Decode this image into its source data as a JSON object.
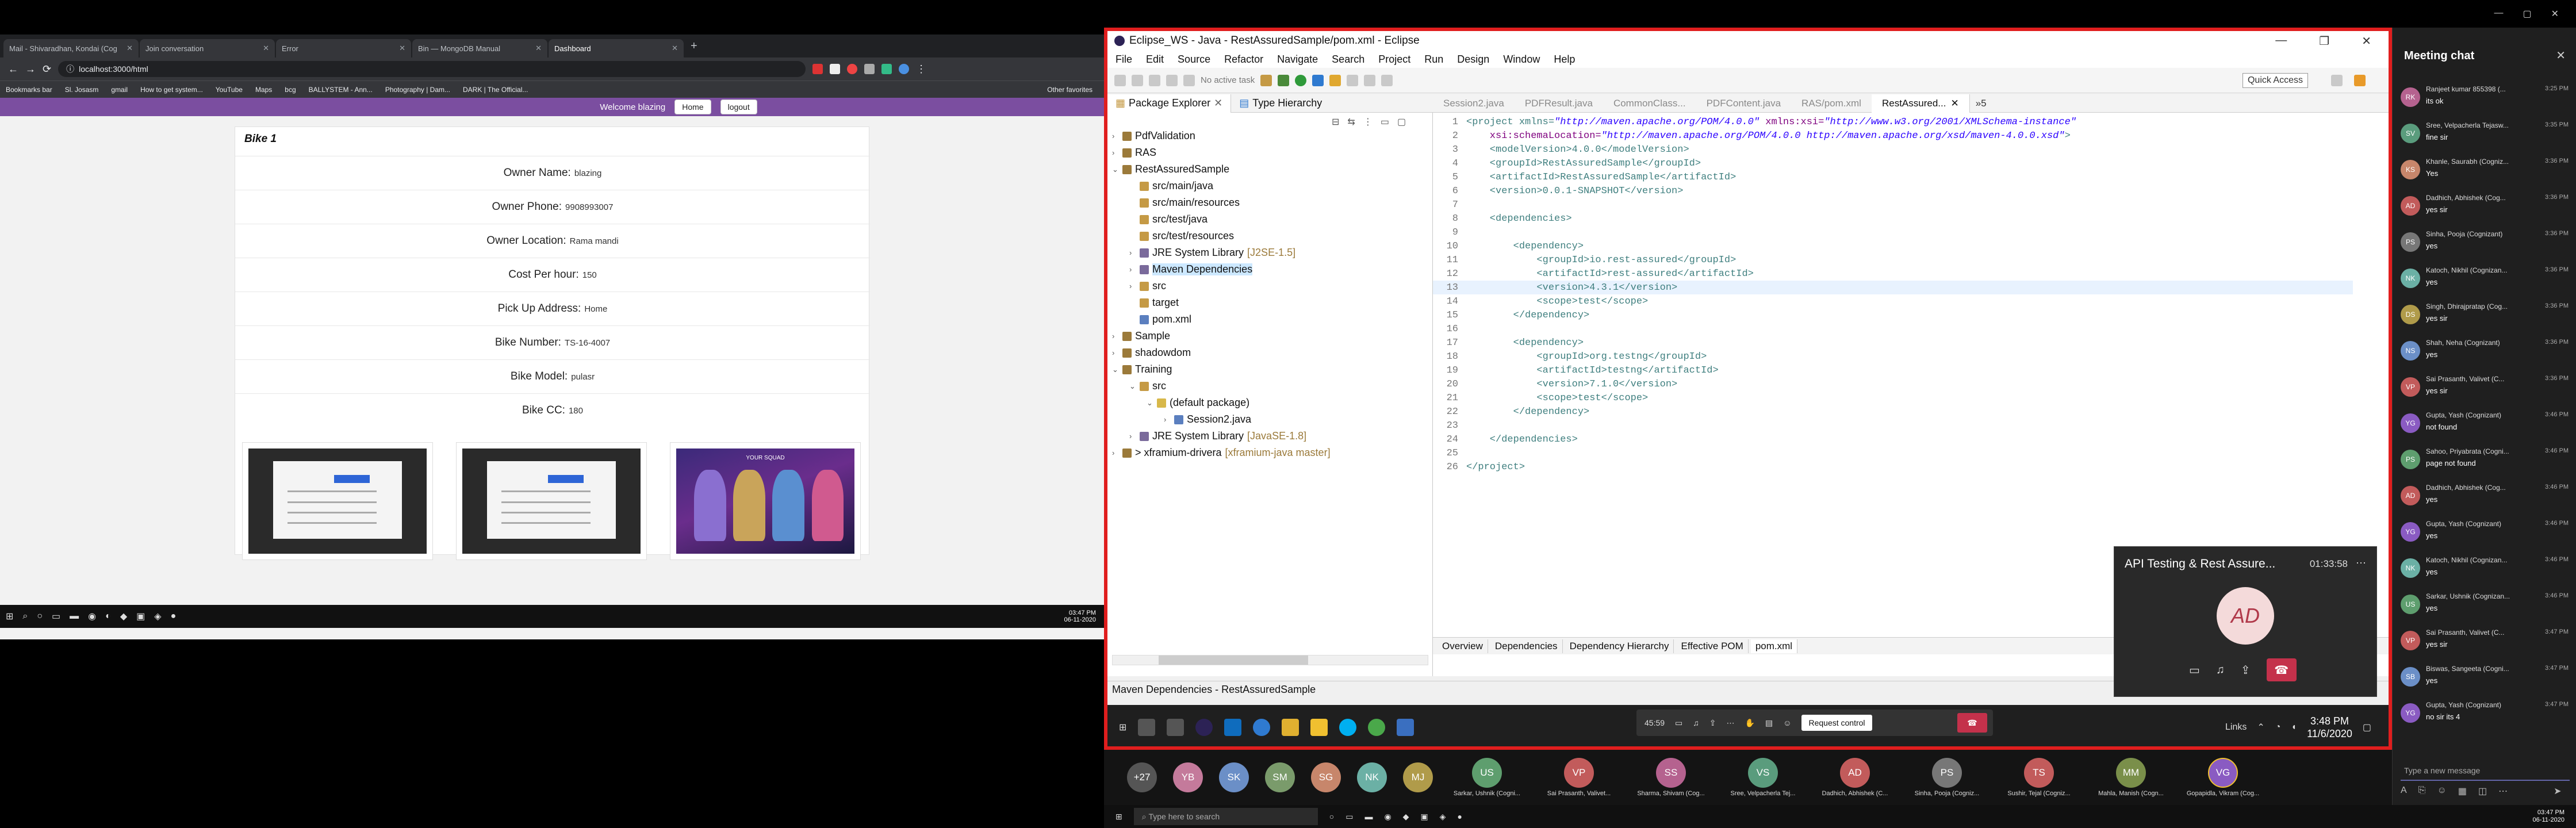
{
  "browser": {
    "tabs": [
      {
        "label": "Mail - Shivaradhan, Kondai (Cog"
      },
      {
        "label": "Join conversation"
      },
      {
        "label": "Error"
      },
      {
        "label": "Bin — MongoDB Manual"
      },
      {
        "label": "Dashboard"
      }
    ],
    "url": "localhost:3000/html",
    "bookmarks": [
      "Bookmarks bar",
      "Sl. Josasm",
      "gmail",
      "How to get system...",
      "YouTube",
      "Maps",
      "bcg",
      "BALLYSTEM - Ann...",
      "Photography | Dam...",
      "DARK | The Official..."
    ],
    "other_bookmarks": "Other favorites"
  },
  "app": {
    "welcome": "Welcome blazing",
    "home": "Home",
    "logout": "logout",
    "card_title": "Bike 1",
    "fields": [
      {
        "label": "Owner Name:",
        "value": "blazing"
      },
      {
        "label": "Owner Phone:",
        "value": "9908993007"
      },
      {
        "label": "Owner Location:",
        "value": "Rama mandi"
      },
      {
        "label": "Cost Per hour:",
        "value": "150"
      },
      {
        "label": "Pick Up Address:",
        "value": "Home"
      },
      {
        "label": "Bike Number:",
        "value": "TS-16-4007"
      },
      {
        "label": "Bike Model:",
        "value": "pulasr"
      },
      {
        "label": "Bike CC:",
        "value": "180"
      }
    ],
    "thumb3_caption": "YOUR SQUAD"
  },
  "left_taskbar": {
    "time": "03:47 PM",
    "date": "06-11-2020"
  },
  "eclipse": {
    "title": "Eclipse_WS - Java - RestAssuredSample/pom.xml - Eclipse",
    "menu": [
      "File",
      "Edit",
      "Source",
      "Refactor",
      "Navigate",
      "Search",
      "Project",
      "Run",
      "Design",
      "Window",
      "Help"
    ],
    "no_active_task": "No active task",
    "quick_access": "Quick Access",
    "pkg_tab": "Package Explorer",
    "type_tab": "Type Hierarchy",
    "tree": [
      {
        "label": "PdfValidation",
        "suffix": ""
      },
      {
        "label": "RAS",
        "suffix": ""
      },
      {
        "label": "RestAssuredSample",
        "suffix": ""
      },
      {
        "label": "src/main/java",
        "suffix": ""
      },
      {
        "label": "src/main/resources",
        "suffix": ""
      },
      {
        "label": "src/test/java",
        "suffix": ""
      },
      {
        "label": "src/test/resources",
        "suffix": ""
      },
      {
        "label": "JRE System Library",
        "suffix": "[J2SE-1.5]"
      },
      {
        "label": "Maven Dependencies",
        "suffix": ""
      },
      {
        "label": "src",
        "suffix": ""
      },
      {
        "label": "target",
        "suffix": ""
      },
      {
        "label": "pom.xml",
        "suffix": ""
      },
      {
        "label": "Sample",
        "suffix": ""
      },
      {
        "label": "shadowdom",
        "suffix": ""
      },
      {
        "label": "Training",
        "suffix": ""
      },
      {
        "label": "src",
        "suffix": ""
      },
      {
        "label": "(default package)",
        "suffix": ""
      },
      {
        "label": "Session2.java",
        "suffix": ""
      },
      {
        "label": "JRE System Library",
        "suffix": "[JavaSE-1.8]"
      },
      {
        "label": "> xframium-drivera",
        "suffix": "[xframium-java master]"
      }
    ],
    "editor_tabs": [
      "Session2.java",
      "PDFResult.java",
      "CommonClass...",
      "PDFContent.java",
      "RAS/pom.xml",
      "RestAssured..."
    ],
    "editor_more": "»5",
    "code_lines": [
      {
        "n": "1",
        "html": "project"
      },
      {
        "n": "2"
      },
      {
        "n": "3"
      },
      {
        "n": "4"
      },
      {
        "n": "5"
      },
      {
        "n": "6"
      },
      {
        "n": "7"
      },
      {
        "n": "8"
      },
      {
        "n": "9"
      },
      {
        "n": "10"
      },
      {
        "n": "11"
      },
      {
        "n": "12"
      },
      {
        "n": "13"
      },
      {
        "n": "14"
      },
      {
        "n": "15"
      },
      {
        "n": "16"
      },
      {
        "n": "17"
      },
      {
        "n": "18"
      },
      {
        "n": "19"
      },
      {
        "n": "20"
      },
      {
        "n": "21"
      },
      {
        "n": "22"
      },
      {
        "n": "23"
      },
      {
        "n": "24"
      },
      {
        "n": "25"
      },
      {
        "n": "26"
      }
    ],
    "code": {
      "l1a": "<project xmlns=",
      "l1b": "\"http://maven.apache.org/POM/4.0.0\"",
      "l1c": " xmlns:xsi=",
      "l1d": "\"http://www.w3.org/2001/XMLSchema-instance\"",
      "l2a": "    xsi:schemaLocation=",
      "l2b": "\"http://maven.apache.org/POM/4.0.0 http://maven.apache.org/xsd/maven-4.0.0.xsd\"",
      "l2c": ">",
      "l3": "    <modelVersion>4.0.0</modelVersion>",
      "l4": "    <groupId>RestAssuredSample</groupId>",
      "l5": "    <artifactId>RestAssuredSample</artifactId>",
      "l6": "    <version>0.0.1-SNAPSHOT</version>",
      "l8": "    <dependencies>",
      "l10": "        <dependency>",
      "l11": "            <groupId>io.rest-assured</groupId>",
      "l12": "            <artifactId>rest-assured</artifactId>",
      "l13": "            <version>4.3.1</version>",
      "l14": "            <scope>test</scope>",
      "l15": "        </dependency>",
      "l17": "        <dependency>",
      "l18": "            <groupId>org.testng</groupId>",
      "l19": "            <artifactId>testng</artifactId>",
      "l20": "            <version>7.1.0</version>",
      "l21": "            <scope>test</scope>",
      "l22": "        </dependency>",
      "l24": "    </dependencies>",
      "l26": "</project>"
    },
    "pom_tabs": [
      "Overview",
      "Dependencies",
      "Dependency Hierarchy",
      "Effective POM",
      "pom.xml"
    ],
    "status": "Maven Dependencies - RestAssuredSample",
    "remote_time": "3:48 PM",
    "remote_date": "11/6/2020",
    "links": "Links",
    "request_control": "Request control",
    "ctrl_timer": "45:59"
  },
  "call": {
    "title": "API Testing & Rest Assure...",
    "duration": "01:33:58",
    "initials": "AD"
  },
  "participants": [
    {
      "i": "+27",
      "c": "#555555",
      "n": ""
    },
    {
      "i": "YB",
      "c": "#c47a9b",
      "n": ""
    },
    {
      "i": "SK",
      "c": "#6b8fc7",
      "n": ""
    },
    {
      "i": "SM",
      "c": "#7a9b6b",
      "n": ""
    },
    {
      "i": "SG",
      "c": "#c7866b",
      "n": ""
    },
    {
      "i": "NK",
      "c": "#6bb0a5",
      "n": ""
    },
    {
      "i": "MJ",
      "c": "#b09b4a",
      "n": ""
    },
    {
      "i": "US",
      "c": "#5e9e6e",
      "n": "Sarkar, Ushnik (Cogni..."
    },
    {
      "i": "VP",
      "c": "#c25b5b",
      "n": "Sai Prasanth, Valivet..."
    },
    {
      "i": "SS",
      "c": "#b5628f",
      "n": "Sharma, Shivam (Cog..."
    },
    {
      "i": "VS",
      "c": "#5a9c7d",
      "n": "Sree, Velpacherla Tej..."
    },
    {
      "i": "AD",
      "c": "#c25b5b",
      "n": "Dadhich, Abhishek (C..."
    },
    {
      "i": "PS",
      "c": "#777777",
      "n": "Sinha, Pooja (Cogniz..."
    },
    {
      "i": "TS",
      "c": "#c25b5b",
      "n": "Sushir, Tejal (Cogniz..."
    },
    {
      "i": "MM",
      "c": "#7a8f4a",
      "n": "Mahla, Manish (Cogn..."
    },
    {
      "i": "VG",
      "c": "#8a5bc2",
      "n": "Gopapidla, Vikram (Cog..."
    }
  ],
  "chat": {
    "title": "Meeting chat",
    "input_placeholder": "Type a new message",
    "messages": [
      {
        "i": "RK",
        "c": "#b5628f",
        "n": "Ranjeet kumar 855398 (...",
        "t": "3:25 PM",
        "x": "its ok"
      },
      {
        "i": "SV",
        "c": "#5a9c7d",
        "n": "Sree, Velpacherla Tejasw...",
        "t": "3:35 PM",
        "x": "fine sir"
      },
      {
        "i": "KS",
        "c": "#c7866b",
        "n": "Khanle, Saurabh (Cogniz...",
        "t": "3:36 PM",
        "x": "Yes"
      },
      {
        "i": "AD",
        "c": "#c25b5b",
        "n": "Dadhich, Abhishek (Cog...",
        "t": "3:36 PM",
        "x": "yes sir"
      },
      {
        "i": "PS",
        "c": "#777777",
        "n": "Sinha, Pooja (Cognizant)",
        "t": "3:36 PM",
        "x": "yes"
      },
      {
        "i": "NK",
        "c": "#6bb0a5",
        "n": "Katoch, Nikhil (Cognizan...",
        "t": "3:36 PM",
        "x": "yes"
      },
      {
        "i": "DS",
        "c": "#b09b4a",
        "n": "Singh, Dhirajpratap (Cog...",
        "t": "3:36 PM",
        "x": "yes sir"
      },
      {
        "i": "NS",
        "c": "#6b8fc7",
        "n": "Shah, Neha (Cognizant)",
        "t": "3:36 PM",
        "x": "yes"
      },
      {
        "i": "VP",
        "c": "#c25b5b",
        "n": "Sai Prasanth, Valivet (C...",
        "t": "3:36 PM",
        "x": "yes sir"
      },
      {
        "i": "YG",
        "c": "#8a5bc2",
        "n": "Gupta, Yash (Cognizant)",
        "t": "3:46 PM",
        "x": "not found"
      },
      {
        "i": "PS",
        "c": "#5e9e6e",
        "n": "Sahoo, Priyabrata (Cogni...",
        "t": "3:46 PM",
        "x": "page not found"
      },
      {
        "i": "AD",
        "c": "#c25b5b",
        "n": "Dadhich, Abhishek (Cog...",
        "t": "3:46 PM",
        "x": "yes"
      },
      {
        "i": "YG",
        "c": "#8a5bc2",
        "n": "Gupta, Yash (Cognizant)",
        "t": "3:46 PM",
        "x": "yes"
      },
      {
        "i": "NK",
        "c": "#6bb0a5",
        "n": "Katoch, Nikhil (Cognizan...",
        "t": "3:46 PM",
        "x": "yes"
      },
      {
        "i": "US",
        "c": "#5e9e6e",
        "n": "Sarkar, Ushnik (Cognizan...",
        "t": "3:46 PM",
        "x": "yes"
      },
      {
        "i": "VP",
        "c": "#c25b5b",
        "n": "Sai Prasanth, Valivet (C...",
        "t": "3:47 PM",
        "x": "yes sir"
      },
      {
        "i": "SB",
        "c": "#6b8fc7",
        "n": "Biswas, Sangeeta (Cogni...",
        "t": "3:47 PM",
        "x": "yes"
      },
      {
        "i": "YG",
        "c": "#8a5bc2",
        "n": "Gupta, Yash (Cognizant)",
        "t": "3:47 PM",
        "x": "no sir its 4"
      }
    ]
  },
  "windows_taskbar": {
    "search": "Type here to search",
    "time": "03:47 PM",
    "date": "06-11-2020"
  },
  "colors": {
    "app_purple": "#7b4ea0",
    "share_border": "#e01e1e",
    "teams_accent": "#6264a7"
  }
}
